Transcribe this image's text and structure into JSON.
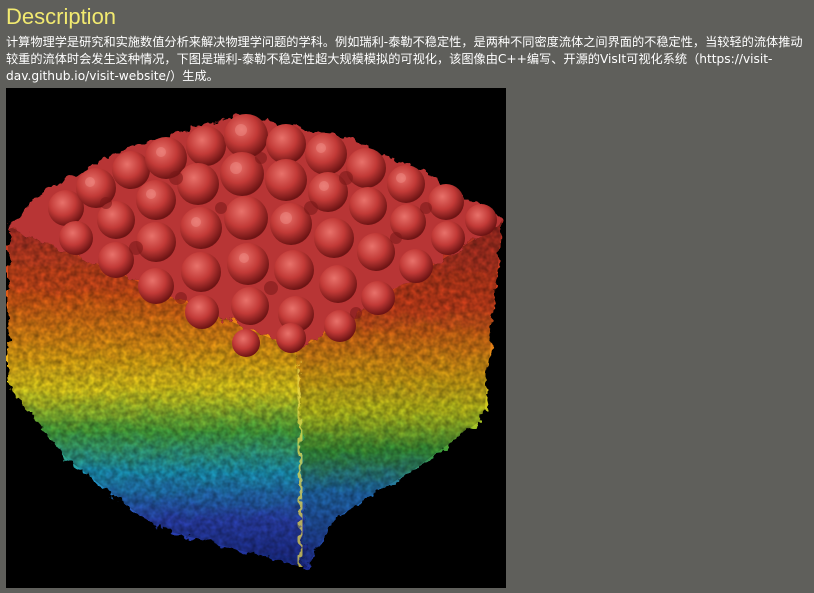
{
  "section": {
    "title": "Description",
    "description": "计算物理学是研究和实施数值分析来解决物理学问题的学科。例如瑞利-泰勒不稳定性，是两种不同密度流体之间界面的不稳定性，当较轻的流体推动较重的流体时会发生这种情况，下图是瑞利-泰勒不稳定性超大规模模拟的可视化，该图像由C++编写、开源的VisIt可视化系统（https://visit-dav.github.io/visit-website/）生成。"
  },
  "image": {
    "subject": "rayleigh-taylor-instability-simulation",
    "colors": {
      "background": "#000000",
      "top_surface": "#c8403f",
      "band_red": "#d23a1c",
      "band_orange": "#f08a10",
      "band_yellow": "#f2e21a",
      "band_green": "#3caa3c",
      "band_cyan": "#1ea8c8",
      "band_blue": "#2a3fb8"
    }
  },
  "theme": {
    "page_background": "#5f5f5b",
    "title_color": "#f2ea70",
    "text_color": "#ffffff"
  }
}
